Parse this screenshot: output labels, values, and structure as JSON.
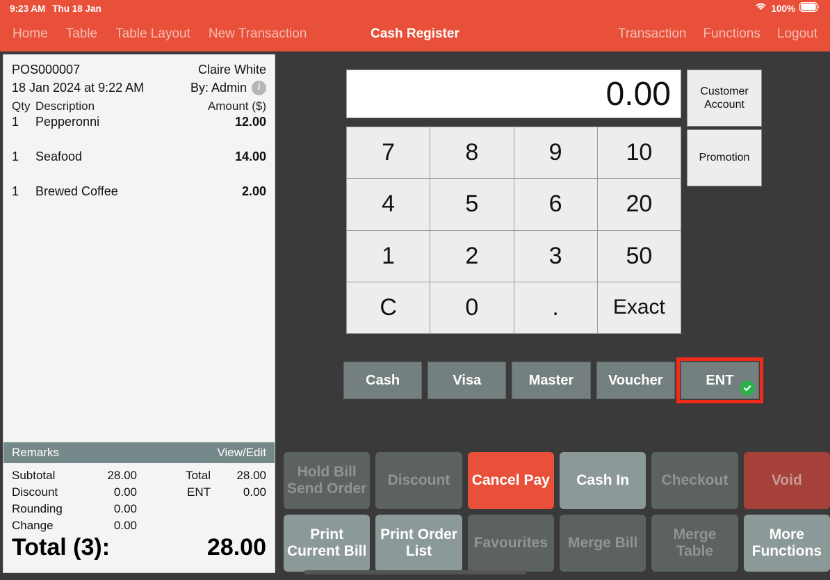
{
  "status_bar": {
    "time": "9:23 AM",
    "date": "Thu 18 Jan",
    "battery_percent": "100%",
    "wifi_icon": "wifi-icon",
    "battery_icon": "battery-icon"
  },
  "nav": {
    "title": "Cash Register",
    "left_items": [
      {
        "label": "Home"
      },
      {
        "label": "Table"
      },
      {
        "label": "Table Layout"
      },
      {
        "label": "New Transaction"
      }
    ],
    "right_items": [
      {
        "label": "Transaction"
      },
      {
        "label": "Functions"
      },
      {
        "label": "Logout"
      }
    ]
  },
  "receipt": {
    "order_no": "POS000007",
    "customer": "Claire White",
    "datetime": "18 Jan 2024 at 9:22 AM",
    "operator": "By: Admin",
    "info_icon": "info-icon",
    "columns": {
      "qty": "Qty",
      "description": "Description",
      "amount": "Amount ($)"
    },
    "items": [
      {
        "qty": "1",
        "description": "Pepperonni",
        "amount": "12.00"
      },
      {
        "qty": "1",
        "description": "Seafood",
        "amount": "14.00"
      },
      {
        "qty": "1",
        "description": "Brewed Coffee",
        "amount": "2.00"
      }
    ],
    "remarks": {
      "label": "Remarks",
      "action": "View/Edit"
    },
    "totals": [
      {
        "label": "Subtotal",
        "value": "28.00",
        "label2": "Total",
        "value2": "28.00"
      },
      {
        "label": "Discount",
        "value": "0.00",
        "label2": "ENT",
        "value2": "0.00"
      },
      {
        "label": "Rounding",
        "value": "0.00",
        "label2": "",
        "value2": ""
      },
      {
        "label": "Change",
        "value": "0.00",
        "label2": "",
        "value2": ""
      }
    ],
    "grand_total": {
      "label": "Total (3):",
      "amount": "28.00"
    }
  },
  "register": {
    "amount_display": "0.00",
    "side_buttons": [
      {
        "label": "Customer Account"
      },
      {
        "label": "Promotion"
      }
    ],
    "keypad": [
      {
        "label": "7"
      },
      {
        "label": "8"
      },
      {
        "label": "9"
      },
      {
        "label": "10"
      },
      {
        "label": "4"
      },
      {
        "label": "5"
      },
      {
        "label": "6"
      },
      {
        "label": "20"
      },
      {
        "label": "1"
      },
      {
        "label": "2"
      },
      {
        "label": "3"
      },
      {
        "label": "50"
      },
      {
        "label": "C"
      },
      {
        "label": "0"
      },
      {
        "label": "."
      },
      {
        "label": "Exact"
      }
    ],
    "payment_buttons": [
      {
        "label": "Cash",
        "selected": false
      },
      {
        "label": "Visa",
        "selected": false
      },
      {
        "label": "Master",
        "selected": false
      },
      {
        "label": "Voucher",
        "selected": false
      },
      {
        "label": "ENT",
        "selected": true
      }
    ],
    "actions": [
      {
        "label": "Hold Bill Send Order",
        "line1": "Hold Bill",
        "line2": "Send Order",
        "state": "disabled"
      },
      {
        "label": "Discount",
        "line1": "Discount",
        "line2": "",
        "state": "disabled"
      },
      {
        "label": "Cancel Pay",
        "line1": "Cancel Pay",
        "line2": "",
        "state": "danger"
      },
      {
        "label": "Cash In",
        "line1": "Cash In",
        "line2": "",
        "state": "enabled"
      },
      {
        "label": "Checkout",
        "line1": "Checkout",
        "line2": "",
        "state": "disabled"
      },
      {
        "label": "Void",
        "line1": "Void",
        "line2": "",
        "state": "void"
      },
      {
        "label": "Print Current Bill",
        "line1": "Print",
        "line2": "Current Bill",
        "state": "enabled"
      },
      {
        "label": "Print Order List",
        "line1": "Print Order",
        "line2": "List",
        "state": "enabled"
      },
      {
        "label": "Favourites",
        "line1": "Favourites",
        "line2": "",
        "state": "disabled"
      },
      {
        "label": "Merge Bill",
        "line1": "Merge Bill",
        "line2": "",
        "state": "disabled"
      },
      {
        "label": "Merge Table",
        "line1": "Merge Table",
        "line2": "",
        "state": "disabled"
      },
      {
        "label": "More Functions",
        "line1": "More",
        "line2": "Functions",
        "state": "enabled"
      }
    ]
  },
  "colors": {
    "brand_red": "#e8503a",
    "highlight_red": "#f42a1a",
    "slate": "#74807f",
    "panel_dark": "#3a3a3a",
    "receipt_bg": "#f4f4f2",
    "remarks_bar": "#76898a",
    "check_green": "#2ab14c",
    "void_red": "#a6413a"
  }
}
